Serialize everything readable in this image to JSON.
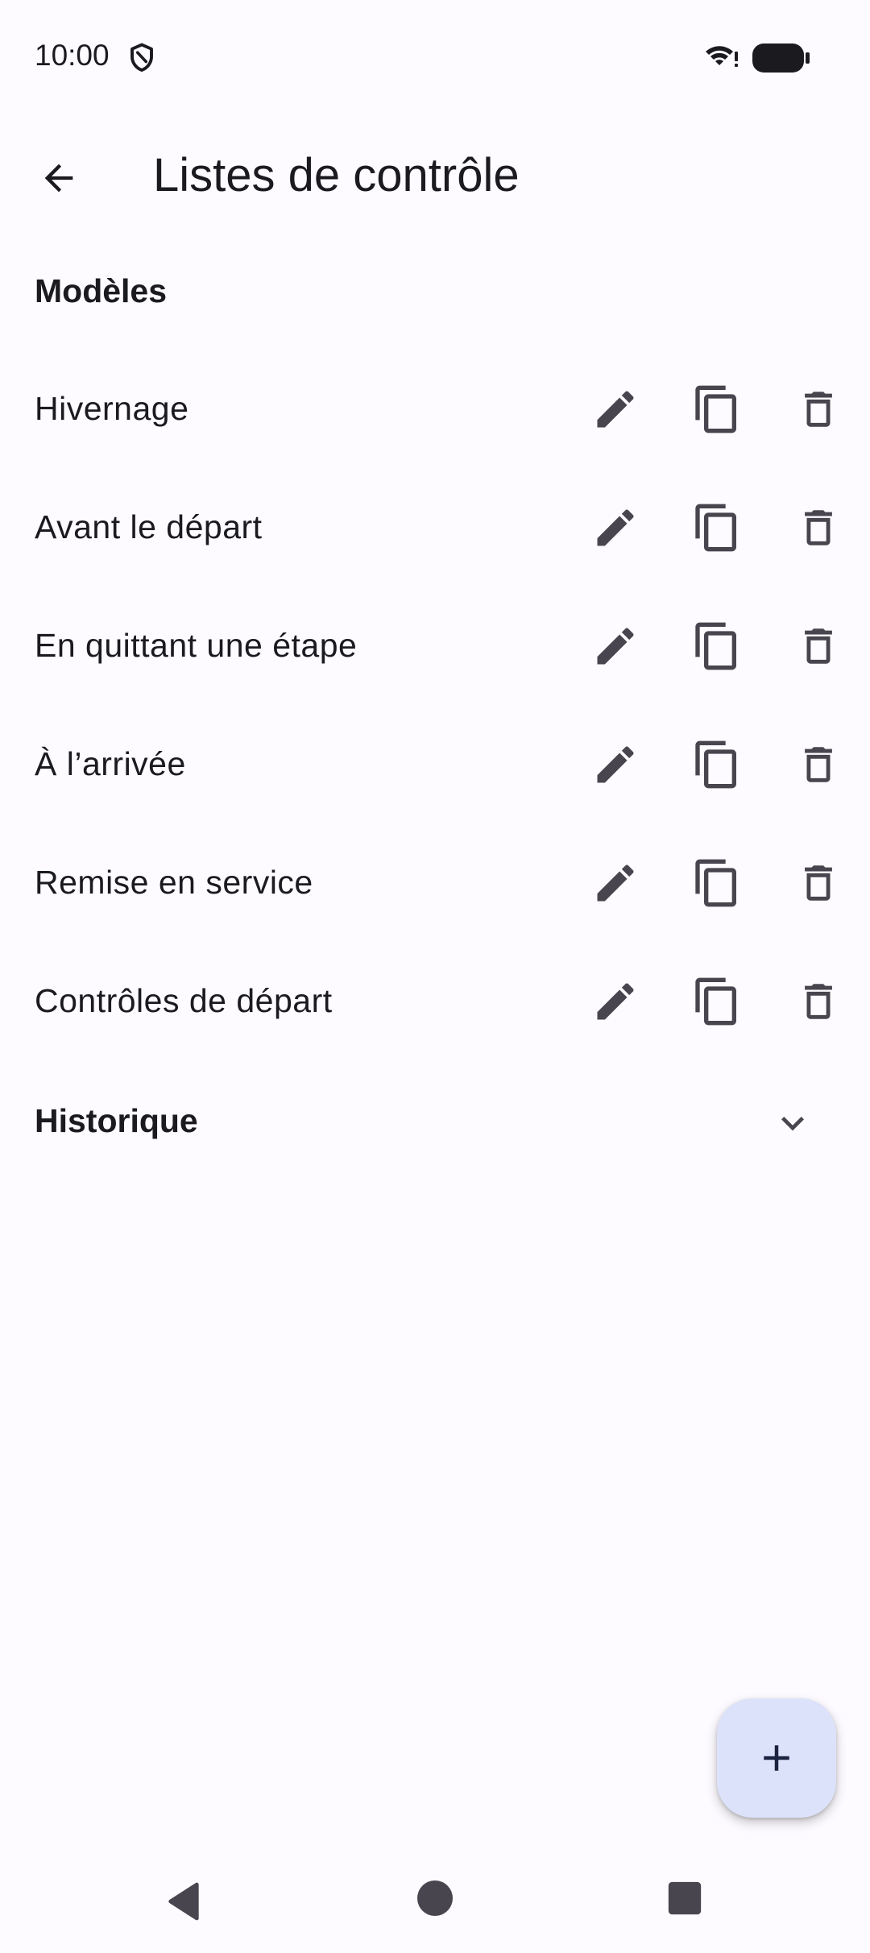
{
  "status_bar": {
    "time": "10:00"
  },
  "app_bar": {
    "title": "Listes de contrôle"
  },
  "sections": {
    "models_label": "Modèles",
    "history_label": "Historique"
  },
  "templates": [
    {
      "label": "Hivernage"
    },
    {
      "label": "Avant le départ"
    },
    {
      "label": "En quittant une étape"
    },
    {
      "label": "À l’arrivée"
    },
    {
      "label": "Remise en service"
    },
    {
      "label": "Contrôles de départ"
    }
  ],
  "icons": {
    "back": "arrow-back-icon",
    "edit": "pencil-icon",
    "copy": "copy-icon",
    "delete": "trash-icon",
    "expand": "chevron-down-icon",
    "fab": "plus-icon"
  },
  "colors": {
    "background": "#fdfbff",
    "icon": "#49454f",
    "fab_background": "#dce2f9",
    "fab_icon": "#1a2340",
    "text": "#1b1b1f"
  }
}
